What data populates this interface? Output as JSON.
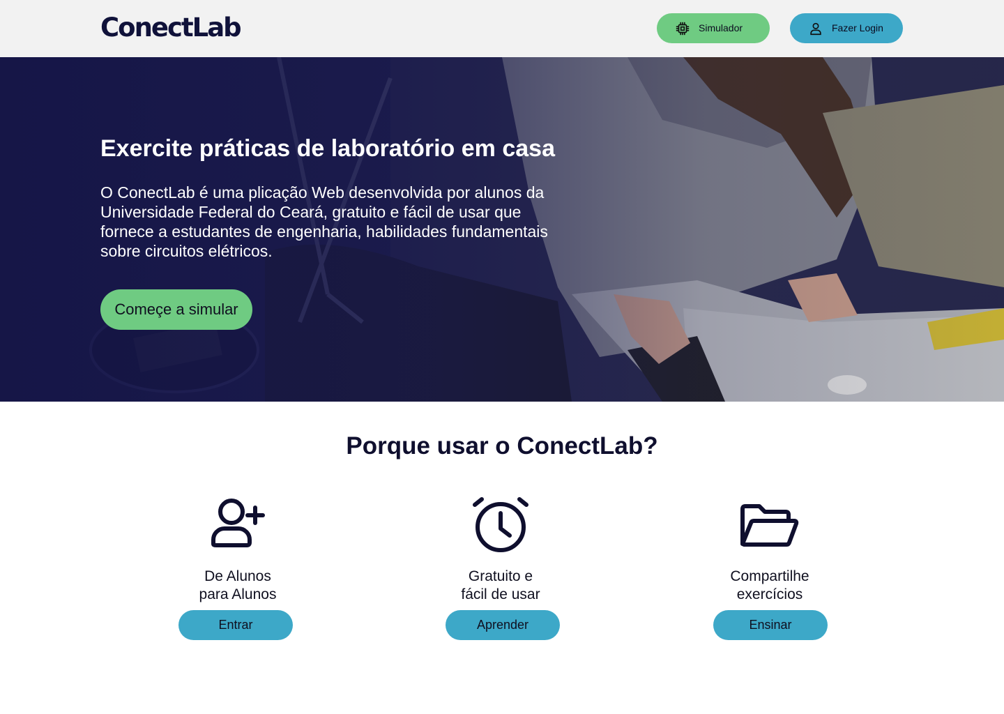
{
  "header": {
    "logo": "ConectLab",
    "simulator_label": "Simulador",
    "login_label": "Fazer Login",
    "simulator_icon": "chip-icon",
    "login_icon": "user-icon"
  },
  "hero": {
    "title": "Exercite práticas de laboratório em casa",
    "description": "O ConectLab é uma plicação Web desenvolvida por alunos da Universidade Federal do Ceará, gratuito e fácil de usar que fornece a estudantes de engenharia, habilidades fundamentais sobre circuitos elétricos.",
    "cta_label": "Começe a simular"
  },
  "why": {
    "title": "Porque usar o ConectLab?",
    "features": [
      {
        "icon": "user-plus-icon",
        "line1": "De Alunos",
        "line2": "para Alunos",
        "button": "Entrar"
      },
      {
        "icon": "alarm-clock-icon",
        "line1": "Gratuito e",
        "line2": "fácil de usar",
        "button": "Aprender"
      },
      {
        "icon": "folder-open-icon",
        "line1": "Compartilhe",
        "line2": "exercícios",
        "button": "Ensinar"
      }
    ]
  },
  "colors": {
    "green": "#6fcb82",
    "blue": "#3da8c8",
    "dark": "#10123a"
  }
}
